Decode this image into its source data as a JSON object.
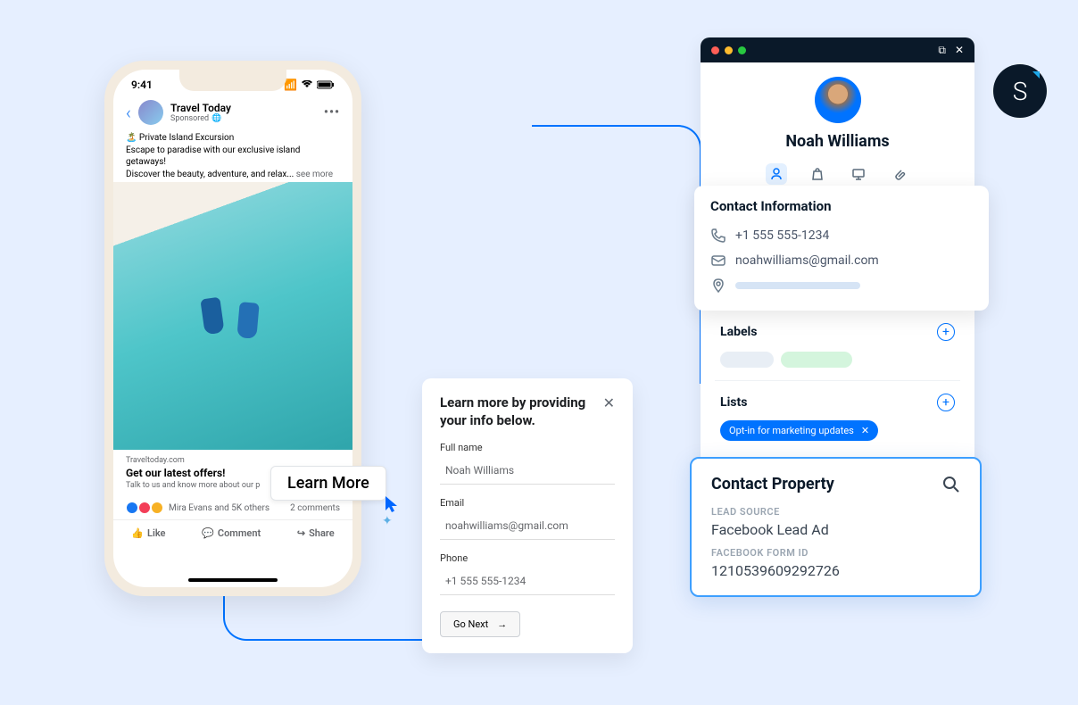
{
  "phone": {
    "status": {
      "time": "9:41"
    },
    "post": {
      "page_name": "Travel Today",
      "sponsored_label": "Sponsored",
      "text_line1": "🏝️ Private Island Excursion",
      "text_line2": "Escape to paradise with our exclusive island getaways!",
      "text_line3": "Discover the beauty, adventure, and relax...",
      "see_more": "see more",
      "link_domain": "Traveltoday.com",
      "link_title": "Get our latest offers!",
      "link_desc": "Talk to us and know more about our p",
      "reactions_text": "Mira Evans and 5K others",
      "comments": "2 comments",
      "like": "Like",
      "comment": "Comment",
      "share": "Share"
    }
  },
  "learn_more": {
    "label": "Learn More"
  },
  "lead_form": {
    "title": "Learn more by providing your info below.",
    "full_name_label": "Full name",
    "full_name_value": "Noah Williams",
    "email_label": "Email",
    "email_value": "noahwilliams@gmail.com",
    "phone_label": "Phone",
    "phone_value": "+1 555 555-1234",
    "go_next": "Go Next"
  },
  "crm": {
    "contact_name": "Noah Williams",
    "contact_info_title": "Contact Information",
    "phone": "+1 555 555-1234",
    "email": "noahwilliams@gmail.com",
    "labels_title": "Labels",
    "lists_title": "Lists",
    "list_chip": "Opt-in for marketing updates",
    "property_title": "Contact Property",
    "lead_source_label": "LEAD SOURCE",
    "lead_source_value": "Facebook Lead Ad",
    "form_id_label": "FACEBOOK FORM ID",
    "form_id_value": "1210539609292726"
  },
  "brand": {
    "letter": "S"
  }
}
